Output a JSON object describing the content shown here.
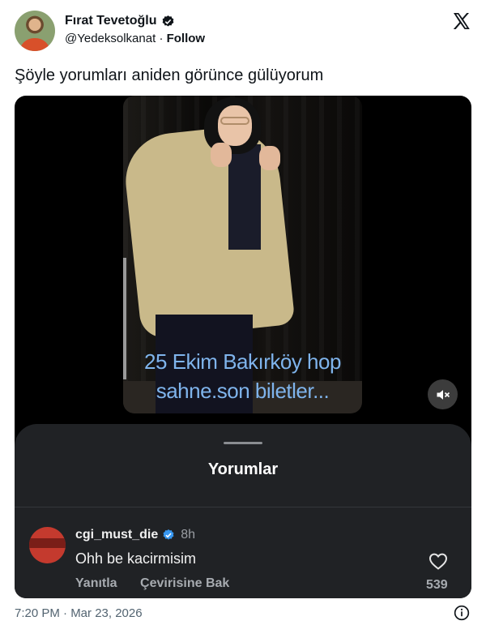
{
  "author": {
    "name": "Fırat Tevetoğlu",
    "handle": "@Yedeksolkanat",
    "separator": "·",
    "follow_label": "Follow"
  },
  "tweet": {
    "text": "Şöyle yorumları aniden görünce  gülüyorum",
    "timestamp": "7:20 PM · Mar 23, 2026"
  },
  "video": {
    "caption_line1": "25 Ekim Bakırköy hop",
    "caption_line2": "sahne.son biletler...",
    "muted_icon": "speaker-muted-icon"
  },
  "comments_sheet": {
    "title": "Yorumlar",
    "comment": {
      "username": "cgi_must_die",
      "time": "8h",
      "text": "Ohh be kacirmisim",
      "reply_label": "Yanıtla",
      "translate_label": "Çevirisine Bak",
      "likes": "539"
    }
  },
  "colors": {
    "verified_badge": "#0f1419",
    "comment_verified": "#3797f0",
    "caption": "#7fb4ec",
    "sheet_bg": "#202225"
  }
}
